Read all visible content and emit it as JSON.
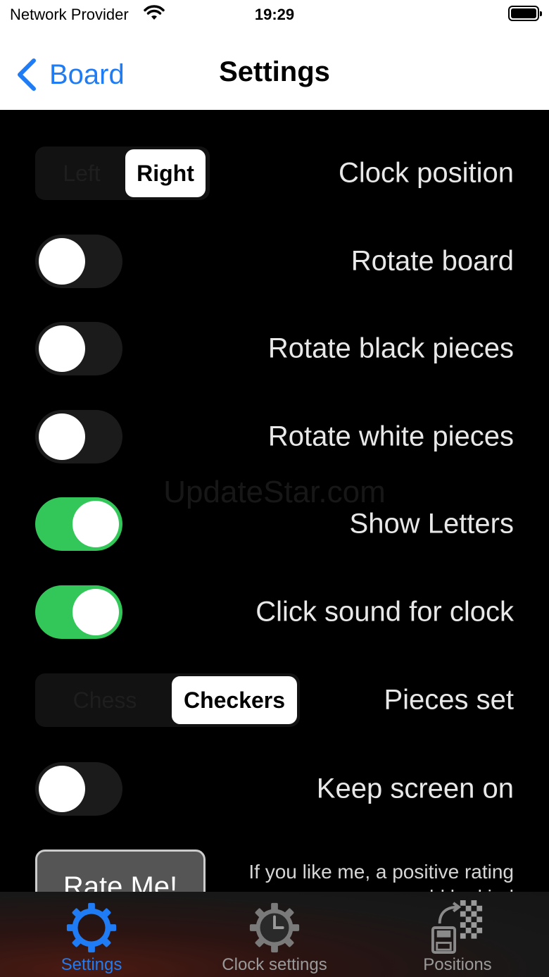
{
  "status_bar": {
    "carrier": "Network Provider",
    "time": "19:29"
  },
  "nav": {
    "back_label": "Board",
    "title": "Settings"
  },
  "settings": {
    "clock_position": {
      "label": "Clock position",
      "options": [
        "Left",
        "Right"
      ],
      "selected": "Right"
    },
    "rotate_board": {
      "label": "Rotate board",
      "on": false
    },
    "rotate_black": {
      "label": "Rotate black pieces",
      "on": false
    },
    "rotate_white": {
      "label": "Rotate white pieces",
      "on": false
    },
    "show_letters": {
      "label": "Show Letters",
      "on": true
    },
    "click_sound": {
      "label": "Click sound for clock",
      "on": true
    },
    "pieces_set": {
      "label": "Pieces set",
      "options": [
        "Chess",
        "Checkers"
      ],
      "selected": "Checkers"
    },
    "keep_screen_on": {
      "label": "Keep screen on",
      "on": false
    }
  },
  "watermark": "UpdateStar.com",
  "rate": {
    "button_label": "Rate Me!",
    "text": "If you like me, a positive rating would be kind"
  },
  "tabs": [
    {
      "label": "Settings",
      "icon": "gear-icon",
      "active": true
    },
    {
      "label": "Clock settings",
      "icon": "clock-gear-icon",
      "active": false
    },
    {
      "label": "Positions",
      "icon": "positions-icon",
      "active": false
    }
  ],
  "colors": {
    "accent": "#1f7cf4",
    "toggle_on": "#33c759",
    "background": "#000000"
  }
}
